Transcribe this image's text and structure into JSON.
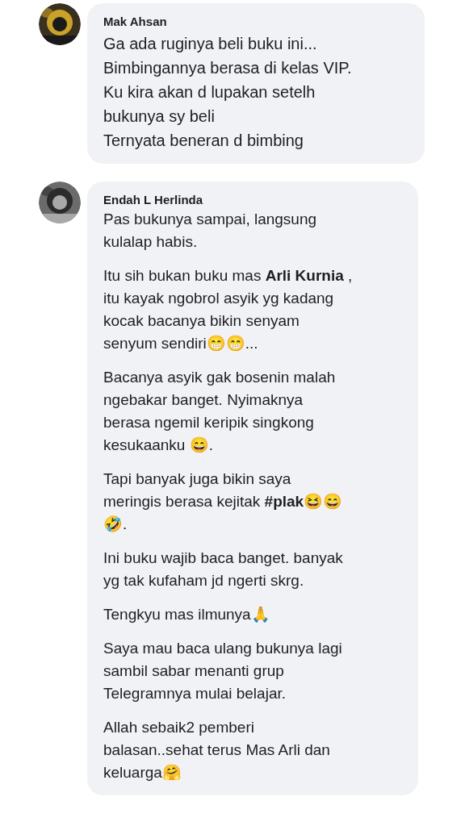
{
  "comments": [
    {
      "author": "Mak Ahsan",
      "avatar": {
        "kind": "picture"
      },
      "paragraphs": [
        "Ga ada ruginya beli buku ini...\nBimbingannya berasa di kelas VIP.\nKu kira akan d lupakan setelh\nbukunya sy beli\nTernyata beneran d bimbing"
      ]
    },
    {
      "author": "Endah L Herlinda",
      "avatar": {
        "kind": "picture"
      },
      "paragraphs": [
        "Pas bukunya sampai, langsung\nkulalap habis.",
        "Itu sih bukan buku mas **Arli Kurnia** ,\nitu kayak ngobrol asyik yg kadang\nkocak bacanya bikin senyam\nsenyum sendiri😁😁...",
        "Bacanya asyik gak bosenin malah\nngebakar banget. Nyimaknya\nberasa ngemil keripik singkong\nkesukaanku 😄.",
        "Tapi banyak juga bikin saya\nmeringis berasa kejitak **#plak**😆😄\n🤣.",
        "Ini buku wajib baca banget. banyak\nyg tak kufaham jd ngerti skrg.",
        "Tengkyu mas ilmunya🙏",
        "Saya mau baca ulang bukunya lagi\nsambil sabar menanti grup\nTelegramnya mulai belajar.",
        "Allah sebaik2 pemberi\nbalasan..sehat terus Mas Arli dan\nkeluarga🤗"
      ]
    }
  ]
}
